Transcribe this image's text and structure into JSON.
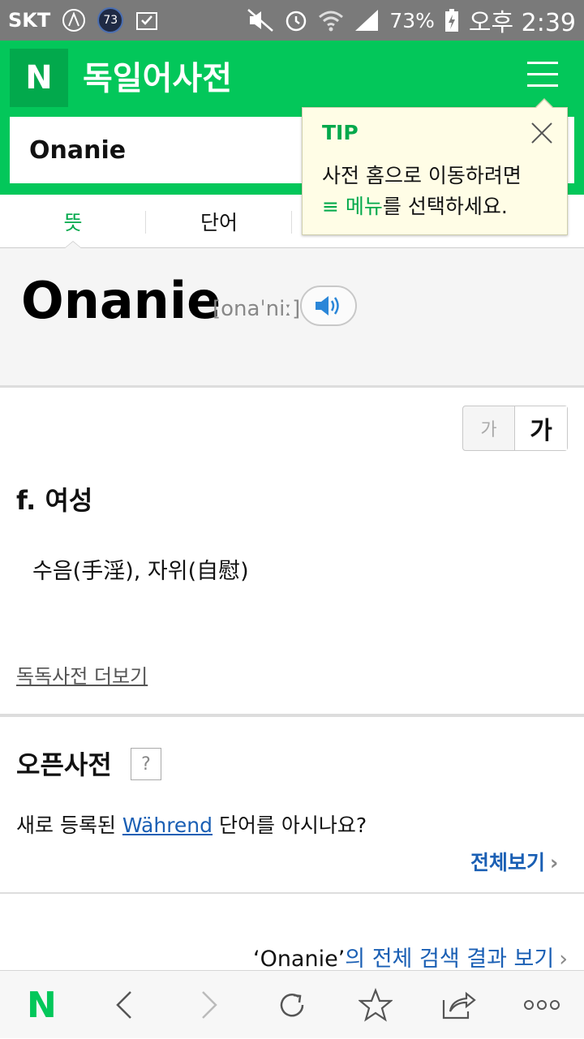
{
  "status_bar": {
    "carrier": "SKT",
    "notification_count": "73",
    "battery": "73%",
    "time": "오후 2:39"
  },
  "header": {
    "logo": "N",
    "title": "독일어사전",
    "search_value": "Onanie"
  },
  "tip": {
    "title": "TIP",
    "line1": "사전 홈으로 이동하려면",
    "menu_label": "≡ 메뉴",
    "line2_rest": "를 선택하세요."
  },
  "tabs": [
    {
      "label": "뜻",
      "active": true
    },
    {
      "label": "단어",
      "active": false
    }
  ],
  "entry": {
    "headword": "Onanie",
    "pronunciation": "[onaˈniː]",
    "part_of_speech": "f. 여성",
    "meaning": "수음(手淫), 자위(自慰)",
    "more_link": "독독사전 더보기"
  },
  "font_toggle": {
    "small": "가",
    "large": "가"
  },
  "open_dict": {
    "title": "오픈사전",
    "help": "?",
    "text_before": "새로 등록된 ",
    "word": "Während",
    "text_after": " 단어를 아시나요?",
    "view_all": "전체보기"
  },
  "full_result": {
    "word": "‘Onanie’",
    "text": "의 전체 검색 결과 보기"
  },
  "bottom_nav": {
    "logo": "N"
  },
  "colors": {
    "brand": "#03c75a",
    "link": "#1a5fb4",
    "tip_bg": "#fffde6"
  }
}
